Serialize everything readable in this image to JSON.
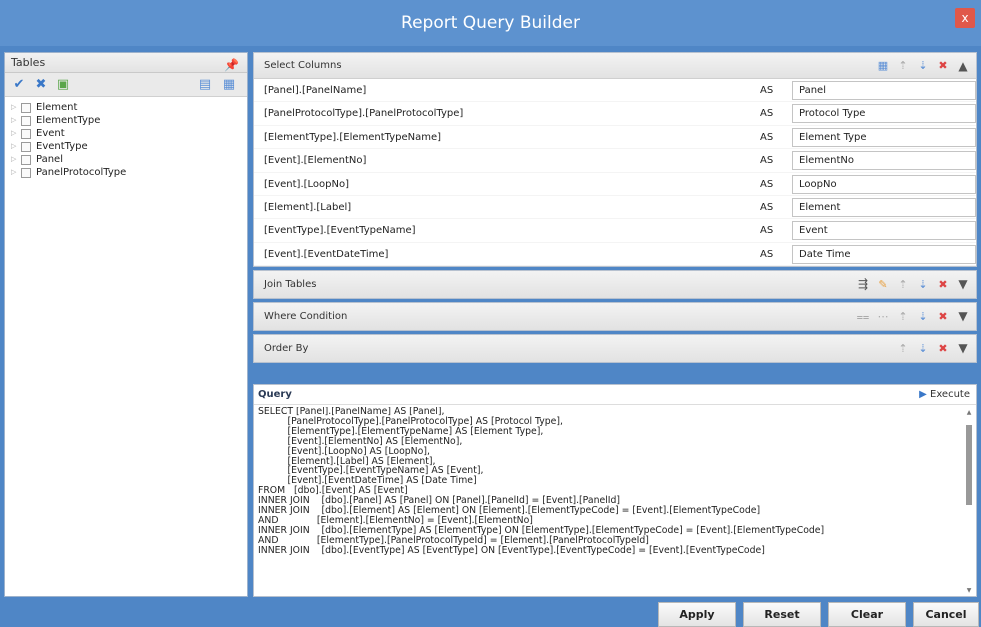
{
  "window": {
    "title": "Report Query Builder",
    "close_label": "x"
  },
  "tables": {
    "header": "Tables",
    "items": [
      "Element",
      "ElementType",
      "Event",
      "EventType",
      "Panel",
      "PanelProtocolType"
    ]
  },
  "select_columns": {
    "header": "Select Columns",
    "rows": [
      {
        "column": "[Panel].[PanelName]",
        "as": "AS",
        "alias": "Panel"
      },
      {
        "column": "[PanelProtocolType].[PanelProtocolType]",
        "as": "AS",
        "alias": "Protocol Type"
      },
      {
        "column": "[ElementType].[ElementTypeName]",
        "as": "AS",
        "alias": "Element Type"
      },
      {
        "column": "[Event].[ElementNo]",
        "as": "AS",
        "alias": "ElementNo"
      },
      {
        "column": "[Event].[LoopNo]",
        "as": "AS",
        "alias": "LoopNo"
      },
      {
        "column": "[Element].[Label]",
        "as": "AS",
        "alias": "Element"
      },
      {
        "column": "[EventType].[EventTypeName]",
        "as": "AS",
        "alias": "Event"
      },
      {
        "column": "[Event].[EventDateTime]",
        "as": "AS",
        "alias": "Date Time"
      }
    ]
  },
  "join_tables": {
    "header": "Join Tables"
  },
  "where_condition": {
    "header": "Where Condition"
  },
  "order_by": {
    "header": "Order By"
  },
  "query": {
    "header": "Query",
    "execute_label": "Execute",
    "text": "SELECT [Panel].[PanelName] AS [Panel],\n          [PanelProtocolType].[PanelProtocolType] AS [Protocol Type],\n          [ElementType].[ElementTypeName] AS [Element Type],\n          [Event].[ElementNo] AS [ElementNo],\n          [Event].[LoopNo] AS [LoopNo],\n          [Element].[Label] AS [Element],\n          [EventType].[EventTypeName] AS [Event],\n          [Event].[EventDateTime] AS [Date Time]\nFROM   [dbo].[Event] AS [Event]\nINNER JOIN    [dbo].[Panel] AS [Panel] ON [Panel].[PanelId] = [Event].[PanelId]\nINNER JOIN    [dbo].[Element] AS [Element] ON [Element].[ElementTypeCode] = [Event].[ElementTypeCode]\nAND             [Element].[ElementNo] = [Event].[ElementNo]\nINNER JOIN    [dbo].[ElementType] AS [ElementType] ON [ElementType].[ElementTypeCode] = [Event].[ElementTypeCode]\nAND             [ElementType].[PanelProtocolTypeId] = [Element].[PanelProtocolTypeId]\nINNER JOIN    [dbo].[EventType] AS [EventType] ON [EventType].[EventTypeCode] = [Event].[EventTypeCode]"
  },
  "buttons": {
    "apply": "Apply",
    "reset": "Reset",
    "clear": "Clear",
    "cancel": "Cancel"
  },
  "colors": {
    "title_bar": "#5d92cf",
    "background": "#4f86c6",
    "close": "#e0584a"
  }
}
